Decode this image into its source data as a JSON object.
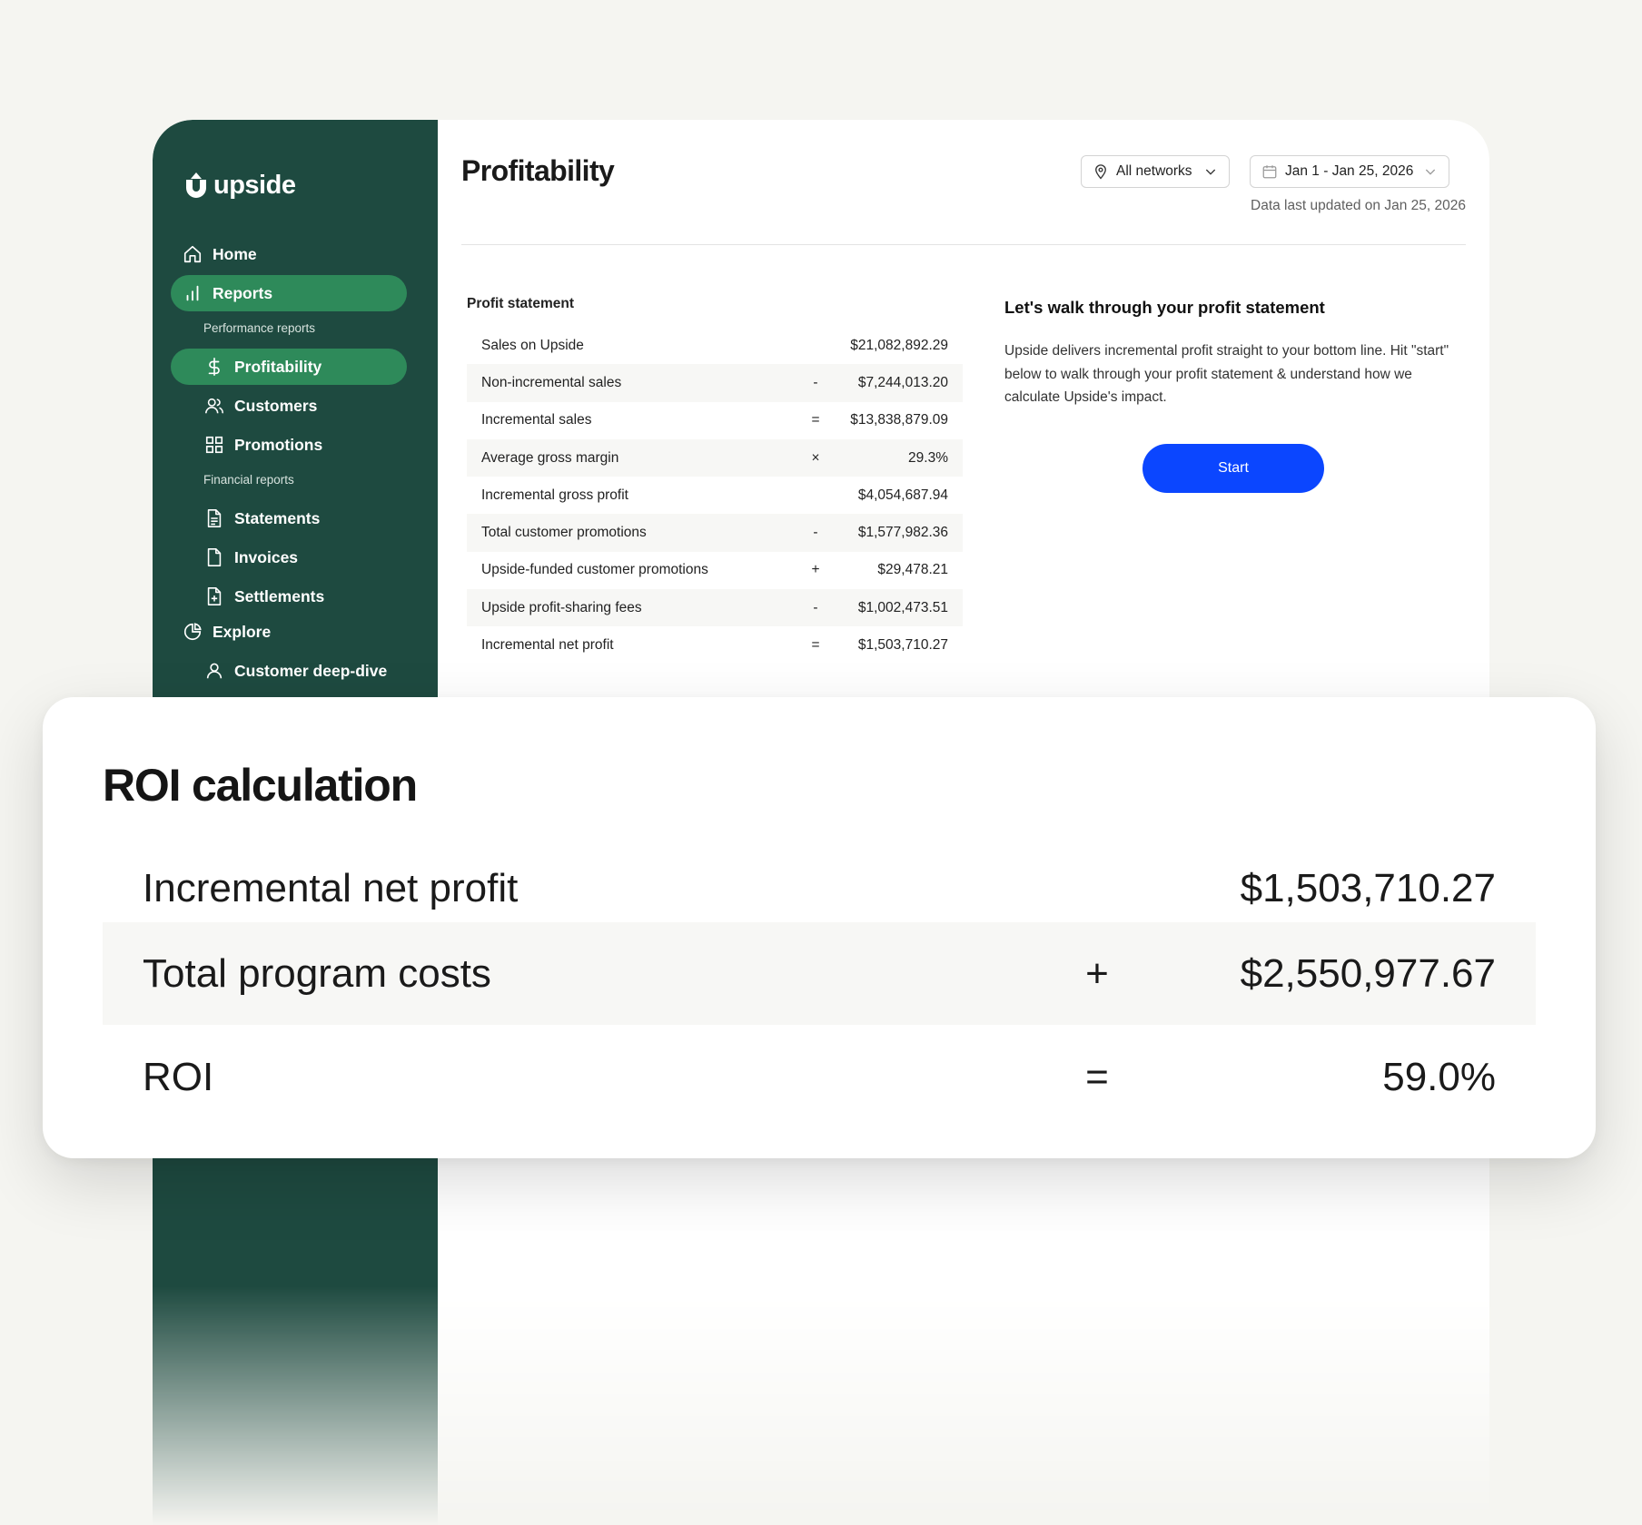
{
  "brand": {
    "name": "upside"
  },
  "sidebar": {
    "home": "Home",
    "reports": "Reports",
    "performance_section": "Performance reports",
    "profitability": "Profitability",
    "customers": "Customers",
    "promotions": "Promotions",
    "financial_section": "Financial reports",
    "statements": "Statements",
    "invoices": "Invoices",
    "settlements": "Settlements",
    "explore": "Explore",
    "customer_deep_dive": "Customer deep-dive"
  },
  "header": {
    "title": "Profitability",
    "network_filter": "All networks",
    "date_range": "Jan 1 - Jan 25, 2026",
    "last_updated": "Data last updated on Jan 25, 2026"
  },
  "profit_statement": {
    "title": "Profit statement",
    "rows": [
      {
        "label": "Sales on Upside",
        "op": "",
        "value": "$21,082,892.29"
      },
      {
        "label": "Non-incremental sales",
        "op": "-",
        "value": "$7,244,013.20"
      },
      {
        "label": "Incremental sales",
        "op": "=",
        "value": "$13,838,879.09"
      },
      {
        "label": "Average gross margin",
        "op": "×",
        "value": "29.3%"
      },
      {
        "label": "Incremental gross profit",
        "op": "",
        "value": "$4,054,687.94"
      },
      {
        "label": "Total customer promotions",
        "op": "-",
        "value": "$1,577,982.36"
      },
      {
        "label": "Upside-funded customer promotions",
        "op": "+",
        "value": "$29,478.21"
      },
      {
        "label": "Upside profit-sharing fees",
        "op": "-",
        "value": "$1,002,473.51"
      },
      {
        "label": "Incremental net profit",
        "op": "=",
        "value": "$1,503,710.27"
      }
    ]
  },
  "walkthrough": {
    "title": "Let's walk through your profit statement",
    "body": "Upside delivers incremental profit straight to your bottom line. Hit \"start\" below to walk through your profit statement & understand how we calculate Upside's impact.",
    "start_label": "Start"
  },
  "roi": {
    "title": "ROI calculation",
    "rows": [
      {
        "label": "Incremental net profit",
        "op": "",
        "value": "$1,503,710.27"
      },
      {
        "label": "Total program costs",
        "op": "+",
        "value": "$2,550,977.67"
      },
      {
        "label": "ROI",
        "op": "=",
        "value": "59.0%"
      }
    ]
  },
  "colors": {
    "sidebar_bg": "#1e4a40",
    "active_nav": "#2e8a5a",
    "primary_button": "#0b46ff",
    "page_bg": "#f5f5f1"
  }
}
